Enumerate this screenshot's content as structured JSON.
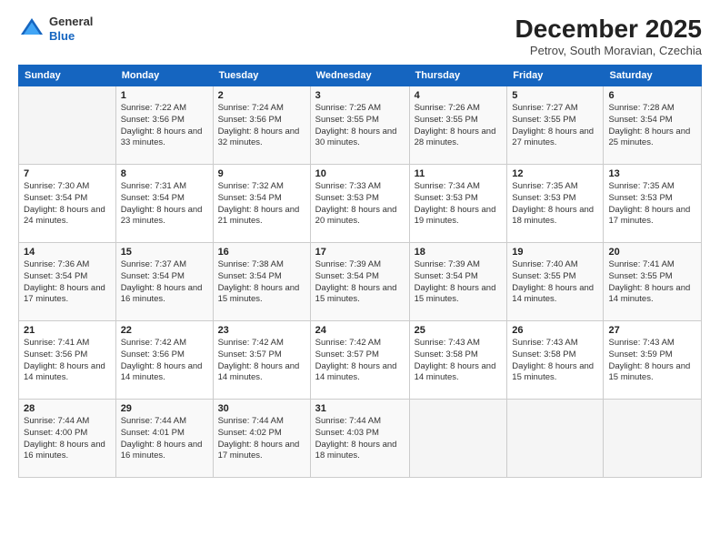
{
  "header": {
    "logo": {
      "line1": "General",
      "line2": "Blue"
    },
    "title": "December 2025",
    "subtitle": "Petrov, South Moravian, Czechia"
  },
  "calendar": {
    "days_of_week": [
      "Sunday",
      "Monday",
      "Tuesday",
      "Wednesday",
      "Thursday",
      "Friday",
      "Saturday"
    ],
    "weeks": [
      [
        {
          "day": "",
          "info": ""
        },
        {
          "day": "1",
          "info": "Sunrise: 7:22 AM\nSunset: 3:56 PM\nDaylight: 8 hours\nand 33 minutes."
        },
        {
          "day": "2",
          "info": "Sunrise: 7:24 AM\nSunset: 3:56 PM\nDaylight: 8 hours\nand 32 minutes."
        },
        {
          "day": "3",
          "info": "Sunrise: 7:25 AM\nSunset: 3:55 PM\nDaylight: 8 hours\nand 30 minutes."
        },
        {
          "day": "4",
          "info": "Sunrise: 7:26 AM\nSunset: 3:55 PM\nDaylight: 8 hours\nand 28 minutes."
        },
        {
          "day": "5",
          "info": "Sunrise: 7:27 AM\nSunset: 3:55 PM\nDaylight: 8 hours\nand 27 minutes."
        },
        {
          "day": "6",
          "info": "Sunrise: 7:28 AM\nSunset: 3:54 PM\nDaylight: 8 hours\nand 25 minutes."
        }
      ],
      [
        {
          "day": "7",
          "info": "Sunrise: 7:30 AM\nSunset: 3:54 PM\nDaylight: 8 hours\nand 24 minutes."
        },
        {
          "day": "8",
          "info": "Sunrise: 7:31 AM\nSunset: 3:54 PM\nDaylight: 8 hours\nand 23 minutes."
        },
        {
          "day": "9",
          "info": "Sunrise: 7:32 AM\nSunset: 3:54 PM\nDaylight: 8 hours\nand 21 minutes."
        },
        {
          "day": "10",
          "info": "Sunrise: 7:33 AM\nSunset: 3:53 PM\nDaylight: 8 hours\nand 20 minutes."
        },
        {
          "day": "11",
          "info": "Sunrise: 7:34 AM\nSunset: 3:53 PM\nDaylight: 8 hours\nand 19 minutes."
        },
        {
          "day": "12",
          "info": "Sunrise: 7:35 AM\nSunset: 3:53 PM\nDaylight: 8 hours\nand 18 minutes."
        },
        {
          "day": "13",
          "info": "Sunrise: 7:35 AM\nSunset: 3:53 PM\nDaylight: 8 hours\nand 17 minutes."
        }
      ],
      [
        {
          "day": "14",
          "info": "Sunrise: 7:36 AM\nSunset: 3:54 PM\nDaylight: 8 hours\nand 17 minutes."
        },
        {
          "day": "15",
          "info": "Sunrise: 7:37 AM\nSunset: 3:54 PM\nDaylight: 8 hours\nand 16 minutes."
        },
        {
          "day": "16",
          "info": "Sunrise: 7:38 AM\nSunset: 3:54 PM\nDaylight: 8 hours\nand 15 minutes."
        },
        {
          "day": "17",
          "info": "Sunrise: 7:39 AM\nSunset: 3:54 PM\nDaylight: 8 hours\nand 15 minutes."
        },
        {
          "day": "18",
          "info": "Sunrise: 7:39 AM\nSunset: 3:54 PM\nDaylight: 8 hours\nand 15 minutes."
        },
        {
          "day": "19",
          "info": "Sunrise: 7:40 AM\nSunset: 3:55 PM\nDaylight: 8 hours\nand 14 minutes."
        },
        {
          "day": "20",
          "info": "Sunrise: 7:41 AM\nSunset: 3:55 PM\nDaylight: 8 hours\nand 14 minutes."
        }
      ],
      [
        {
          "day": "21",
          "info": "Sunrise: 7:41 AM\nSunset: 3:56 PM\nDaylight: 8 hours\nand 14 minutes."
        },
        {
          "day": "22",
          "info": "Sunrise: 7:42 AM\nSunset: 3:56 PM\nDaylight: 8 hours\nand 14 minutes."
        },
        {
          "day": "23",
          "info": "Sunrise: 7:42 AM\nSunset: 3:57 PM\nDaylight: 8 hours\nand 14 minutes."
        },
        {
          "day": "24",
          "info": "Sunrise: 7:42 AM\nSunset: 3:57 PM\nDaylight: 8 hours\nand 14 minutes."
        },
        {
          "day": "25",
          "info": "Sunrise: 7:43 AM\nSunset: 3:58 PM\nDaylight: 8 hours\nand 14 minutes."
        },
        {
          "day": "26",
          "info": "Sunrise: 7:43 AM\nSunset: 3:58 PM\nDaylight: 8 hours\nand 15 minutes."
        },
        {
          "day": "27",
          "info": "Sunrise: 7:43 AM\nSunset: 3:59 PM\nDaylight: 8 hours\nand 15 minutes."
        }
      ],
      [
        {
          "day": "28",
          "info": "Sunrise: 7:44 AM\nSunset: 4:00 PM\nDaylight: 8 hours\nand 16 minutes."
        },
        {
          "day": "29",
          "info": "Sunrise: 7:44 AM\nSunset: 4:01 PM\nDaylight: 8 hours\nand 16 minutes."
        },
        {
          "day": "30",
          "info": "Sunrise: 7:44 AM\nSunset: 4:02 PM\nDaylight: 8 hours\nand 17 minutes."
        },
        {
          "day": "31",
          "info": "Sunrise: 7:44 AM\nSunset: 4:03 PM\nDaylight: 8 hours\nand 18 minutes."
        },
        {
          "day": "",
          "info": ""
        },
        {
          "day": "",
          "info": ""
        },
        {
          "day": "",
          "info": ""
        }
      ]
    ]
  }
}
